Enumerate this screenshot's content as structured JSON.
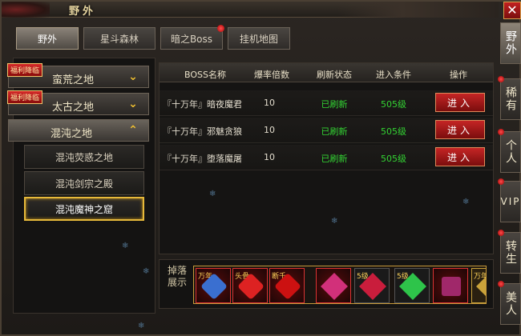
{
  "window": {
    "title": "野外",
    "close_label": "✕"
  },
  "tabs": [
    {
      "label": "野外",
      "active": true,
      "has_dot": false
    },
    {
      "label": "星斗森林",
      "active": false,
      "has_dot": false
    },
    {
      "label": "暗之Boss",
      "active": false,
      "has_dot": true
    },
    {
      "label": "挂机地图",
      "active": false,
      "has_dot": false
    }
  ],
  "categories": [
    {
      "label": "蛮荒之地",
      "badge": "福利降临",
      "open": false
    },
    {
      "label": "太古之地",
      "badge": "福利降临",
      "open": false
    },
    {
      "label": "混沌之地",
      "badge": "",
      "open": true
    }
  ],
  "subcategories": [
    {
      "label": "混沌荧惑之地",
      "selected": false
    },
    {
      "label": "混沌剑宗之殿",
      "selected": false
    },
    {
      "label": "混沌魔神之窟",
      "selected": true
    }
  ],
  "table": {
    "headers": [
      "BOSS名称",
      "爆率倍数",
      "刷新状态",
      "进入条件",
      "操作"
    ],
    "rows": [
      {
        "name": "『十万年』暗夜魔君",
        "rate": "10",
        "status": "已刷新",
        "condition": "505级",
        "action": "进入"
      },
      {
        "name": "『十万年』邪魅贪狼",
        "rate": "10",
        "status": "已刷新",
        "condition": "505级",
        "action": "进入"
      },
      {
        "name": "『十万年』堕落魔屠",
        "rate": "10",
        "status": "已刷新",
        "condition": "505级",
        "action": "进入"
      }
    ]
  },
  "drops": {
    "label": "掉落展示",
    "items": [
      {
        "tag": "万年",
        "icon": "blue-beast-icon"
      },
      {
        "tag": "头骨",
        "icon": "red-dragon-icon"
      },
      {
        "tag": "断千",
        "icon": "red-dragon-icon"
      },
      {
        "tag": "",
        "icon": "pink-gem-icon"
      },
      {
        "tag": "5级",
        "icon": "red-gem-icon"
      },
      {
        "tag": "5级",
        "icon": "green-gem-icon"
      },
      {
        "tag": "",
        "icon": "treasure-chest-icon"
      },
      {
        "tag": "万年",
        "icon": "gold-item-icon"
      }
    ]
  },
  "side_tabs": [
    {
      "label": "野外",
      "active": true
    },
    {
      "label": "稀有",
      "active": false
    },
    {
      "label": "个人",
      "active": false
    },
    {
      "label": "VIP",
      "active": false
    },
    {
      "label": "转生",
      "active": false
    },
    {
      "label": "美人",
      "active": false
    }
  ],
  "colors": {
    "status_green": "#33d433",
    "accent_gold": "#e7b93a",
    "button_red": "#c52525"
  }
}
